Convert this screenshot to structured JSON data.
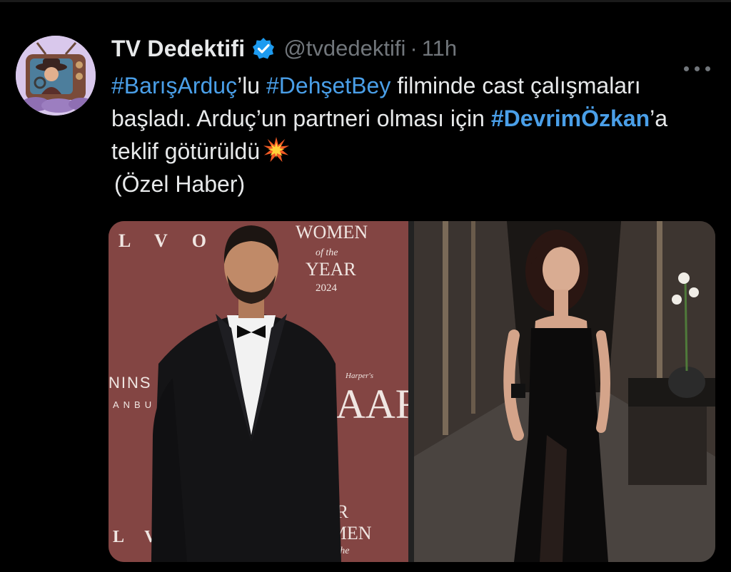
{
  "tweet": {
    "author_name": "TV Dedektifi",
    "handle": "@tvdedektifi",
    "separator": "·",
    "time": "11h",
    "more_icon": "more-horizontal-icon",
    "verified_icon": "verified-badge-icon",
    "text": {
      "hashtag1": "#BarışArduç",
      "after_hashtag1": "’lu ",
      "hashtag2": "#DehşetBey",
      "after_hashtag2": " filminde cast çalışmaları başladı. Arduç’un partneri olması için ",
      "hashtag3": "#DevrimÖzkan",
      "after_hashtag3": "’a teklif götürüldü",
      "emoji_icon": "collision-emoji-icon",
      "line4": "(Özel Haber)"
    },
    "media": {
      "left_photo": {
        "backdrop_texts": [
          "L V O",
          "WOMEN",
          "of the",
          "YEAR",
          "2024",
          "NINS",
          "ANBU",
          "Harper's",
          "AAR",
          "AR",
          "OMEN",
          "of the",
          "L V"
        ]
      },
      "right_photo": {}
    }
  },
  "colors": {
    "background": "#000000",
    "text": "#e7e9ea",
    "secondary": "#71767b",
    "link": "#4a9fe8",
    "verified": "#1d9bf0"
  }
}
